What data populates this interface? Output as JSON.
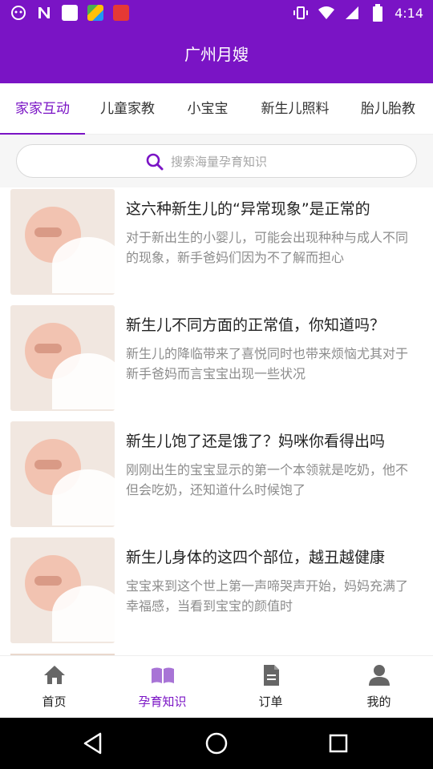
{
  "status_bar": {
    "time": "4:14",
    "left_icons": [
      "app-notification-icon",
      "n-notification-icon",
      "white-app-icon",
      "colorful-app-icon",
      "red-app-icon"
    ],
    "right_icons": [
      "vibrate-icon",
      "wifi-icon",
      "signal-icon",
      "battery-icon"
    ]
  },
  "header": {
    "title": "广州月嫂"
  },
  "tabs": [
    {
      "label": "家家互动",
      "active": true
    },
    {
      "label": "儿童家教",
      "active": false
    },
    {
      "label": "小宝宝",
      "active": false
    },
    {
      "label": "新生儿照料",
      "active": false
    },
    {
      "label": "胎儿胎教",
      "active": false
    }
  ],
  "search": {
    "placeholder": "搜索海量孕育知识"
  },
  "articles": [
    {
      "title": "这六种新生儿的“异常现象”是正常的",
      "summary": "对于新出生的小婴儿，可能会出现种种与成人不同的现象，新手爸妈们因为不了解而担心"
    },
    {
      "title": "新生儿不同方面的正常值，你知道吗？",
      "summary": "新生儿的降临带来了喜悦同时也带来烦恼尤其对于新手爸妈而言宝宝出现一些状况"
    },
    {
      "title": "新生儿饱了还是饿了？妈咪你看得出吗",
      "summary": "刚刚出生的宝宝显示的第一个本领就是吃奶，他不但会吃奶，还知道什么时候饱了"
    },
    {
      "title": "新生儿身体的这四个部位，越丑越健康",
      "summary": "宝宝来到这个世上第一声啼哭声开始，妈妈充满了幸福感，当看到宝宝的颜值时"
    }
  ],
  "bottom_nav": [
    {
      "label": "首页",
      "icon": "home-icon",
      "active": false
    },
    {
      "label": "孕育知识",
      "icon": "book-icon",
      "active": true
    },
    {
      "label": "订单",
      "icon": "document-icon",
      "active": false
    },
    {
      "label": "我的",
      "icon": "person-icon",
      "active": false
    }
  ],
  "system_nav": [
    "back-icon",
    "home-circle-icon",
    "recents-icon"
  ],
  "colors": {
    "primary": "#7a14c5",
    "text": "#222222",
    "muted": "#8c8c8c"
  }
}
